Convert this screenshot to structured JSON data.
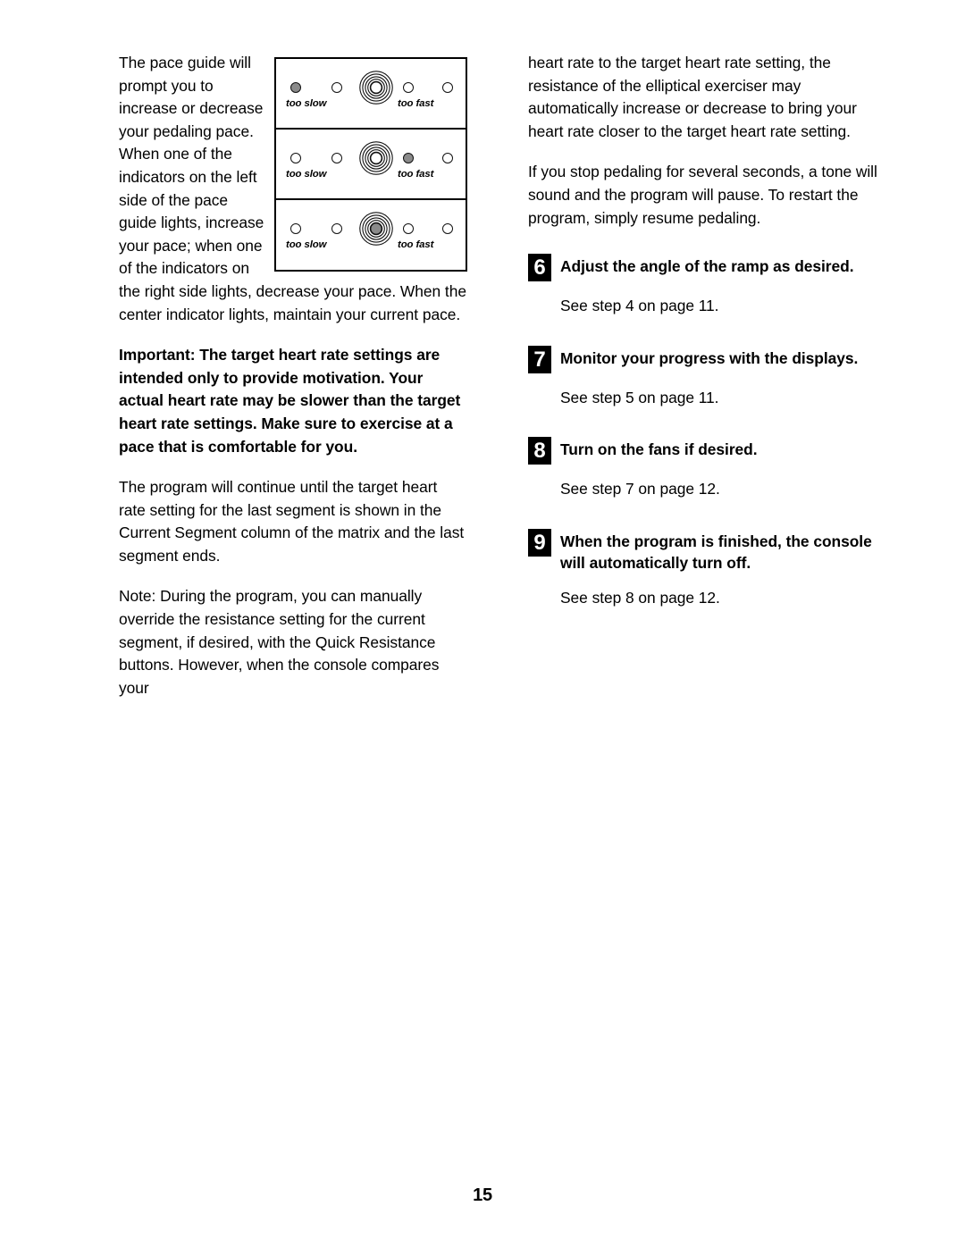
{
  "document": {
    "page_number": "15"
  },
  "left_column": {
    "wrap_paragraph": "The pace guide will prompt you to increase or decrease your pedaling pace. When one of the indicators on the left side of the pace guide lights, increase your pace; when one of the indicators on the right side lights, decrease your pace. When the center indicator lights, maintain your current pace.",
    "important_paragraph": "Important: The target heart rate settings are intended only to provide motivation. Your actual heart rate may be slower than the target heart rate settings. Make sure to exercise at a pace that is comfortable for you.",
    "continue_paragraph": "The program will continue until the target heart rate setting for the last segment is shown in the Current Segment column of the matrix and the last segment ends.",
    "note_paragraph": "Note: During the program, you can manually override the resistance setting for the current segment, if desired, with the Quick Resistance buttons. However, when the console compares your"
  },
  "figure": {
    "label_slow": "too slow",
    "label_fast": "too fast",
    "panels": [
      {
        "name": "pace-panel-too-slow",
        "lit": "left-outer"
      },
      {
        "name": "pace-panel-too-fast",
        "lit": "right-inner"
      },
      {
        "name": "pace-panel-on-pace",
        "lit": "center"
      }
    ],
    "colors": {
      "lamp_on": "#8a8a8a",
      "lamp_off": "#ffffff",
      "outline": "#111111"
    }
  },
  "right_column": {
    "continued_paragraph": "heart rate to the target heart rate setting, the resistance of the elliptical exerciser may automatically increase or decrease to bring your heart rate closer to the target heart rate setting.",
    "pause_paragraph": "If you stop pedaling for several seconds, a tone will sound and the program will pause. To restart the program, simply resume pedaling.",
    "steps": [
      {
        "number": "6",
        "title": "Adjust the angle of the ramp as desired.",
        "body": "See step 4 on page 11."
      },
      {
        "number": "7",
        "title": "Monitor your progress with the displays.",
        "body": "See step 5 on page 11."
      },
      {
        "number": "8",
        "title": "Turn on the fans if desired.",
        "body": "See step 7 on page 12."
      },
      {
        "number": "9",
        "title": "When the program is finished, the console will automatically turn off.",
        "body": "See step 8 on page 12."
      }
    ]
  }
}
